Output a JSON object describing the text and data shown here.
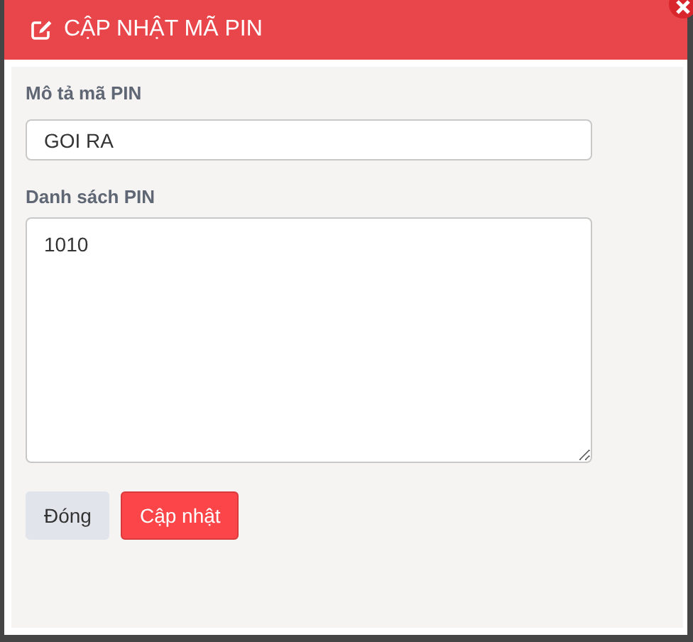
{
  "dialog": {
    "title": "CẬP NHẬT MÃ PIN",
    "fields": [
      {
        "kind": "input",
        "label": "Mô tả mã PIN",
        "value": "GOI RA"
      },
      {
        "kind": "textarea",
        "label": "Danh sách PIN",
        "value": "1010"
      }
    ],
    "buttons": [
      {
        "kind": "secondary",
        "label": "Đóng"
      },
      {
        "kind": "primary",
        "label": "Cập nhật"
      }
    ]
  }
}
